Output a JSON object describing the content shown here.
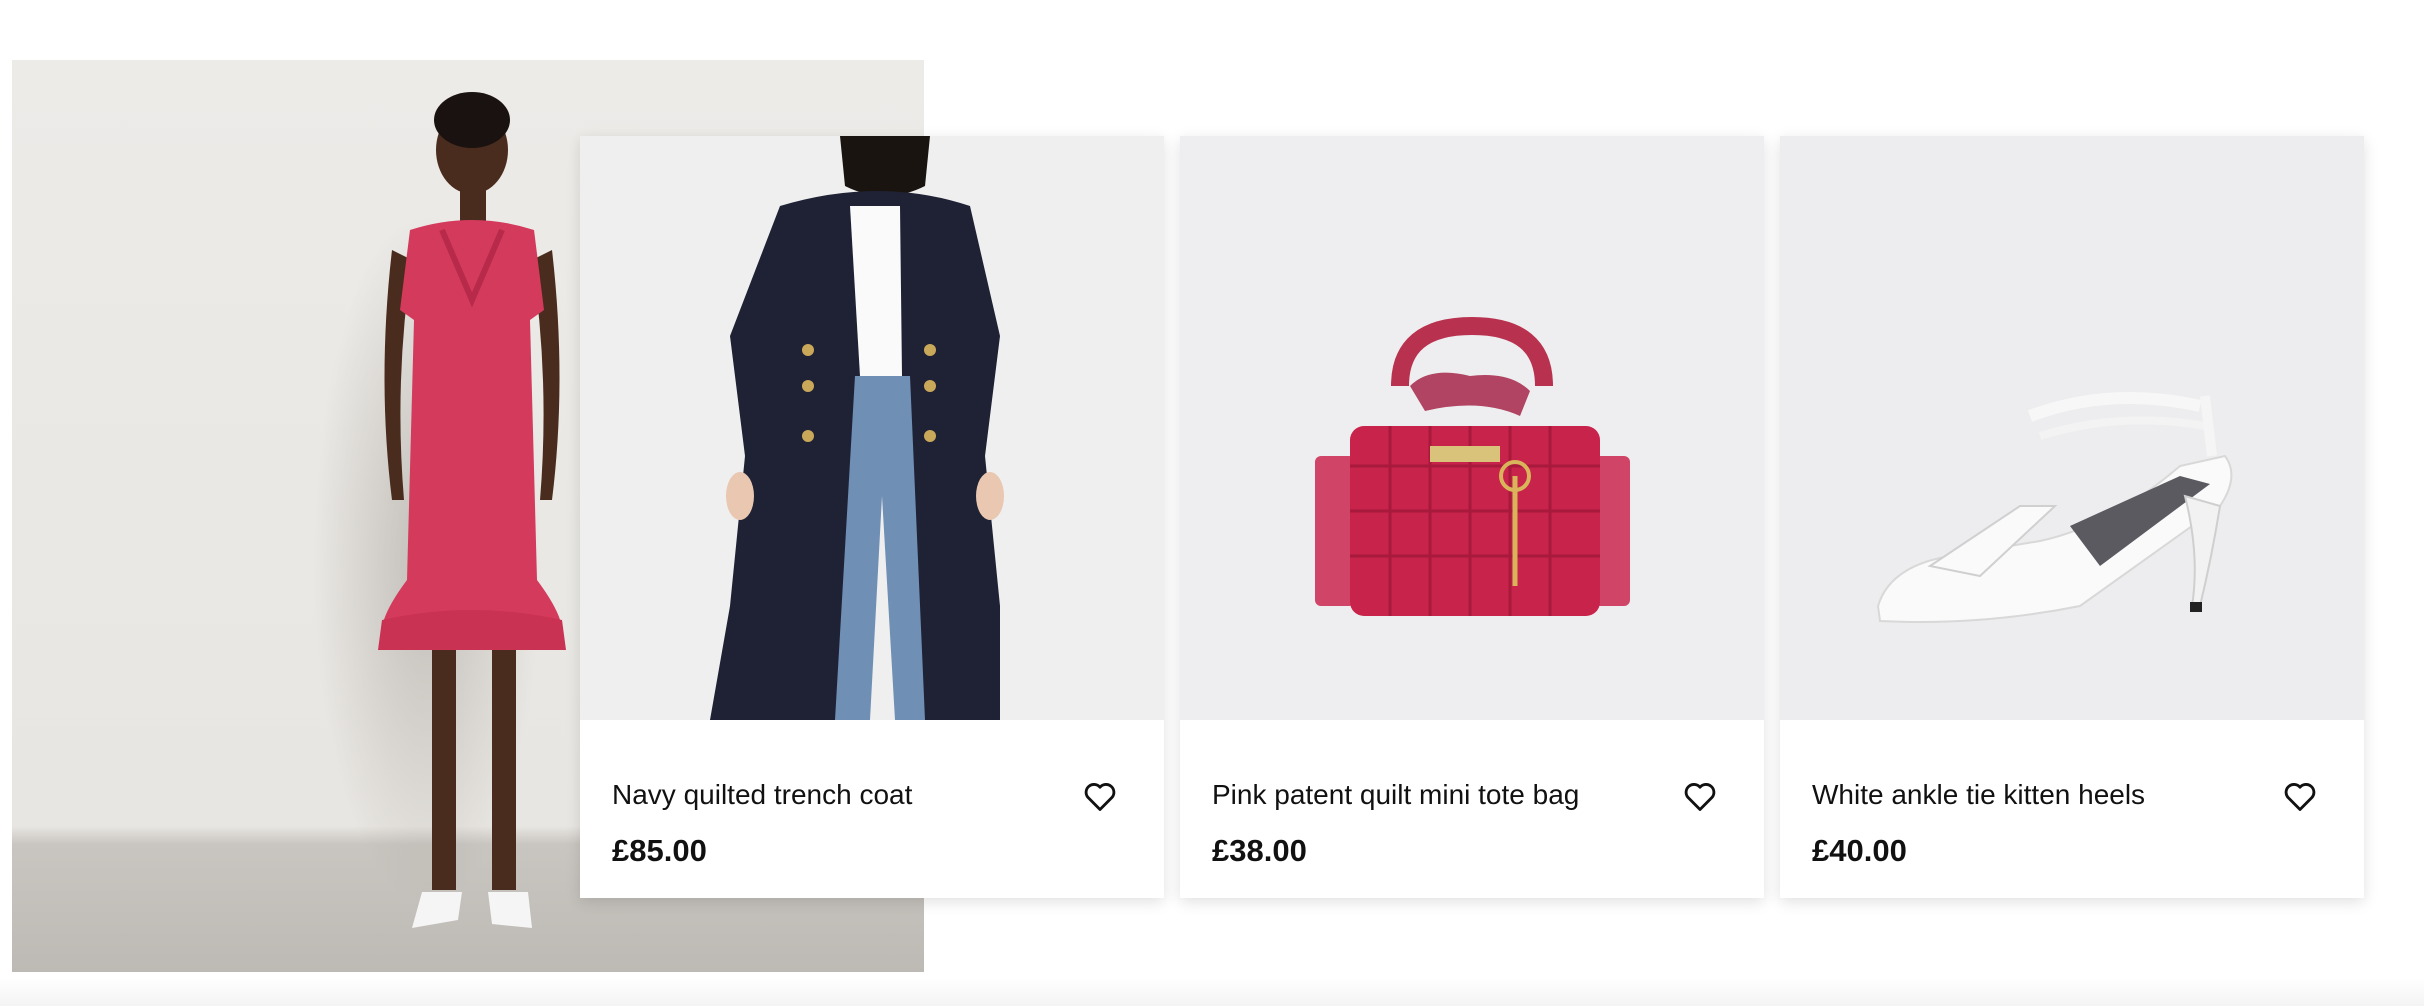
{
  "products": [
    {
      "name": "Navy quilted trench coat",
      "price": "£85.00"
    },
    {
      "name": "Pink patent quilt mini tote bag",
      "price": "£38.00"
    },
    {
      "name": "White ankle tie kitten heels",
      "price": "£40.00"
    }
  ],
  "icons": {
    "wishlist": "heart-outline-icon"
  },
  "colors": {
    "text": "#111111",
    "card_background": "#ffffff",
    "image_background": "#eeeef0",
    "accent_pink": "#d43a5c"
  }
}
